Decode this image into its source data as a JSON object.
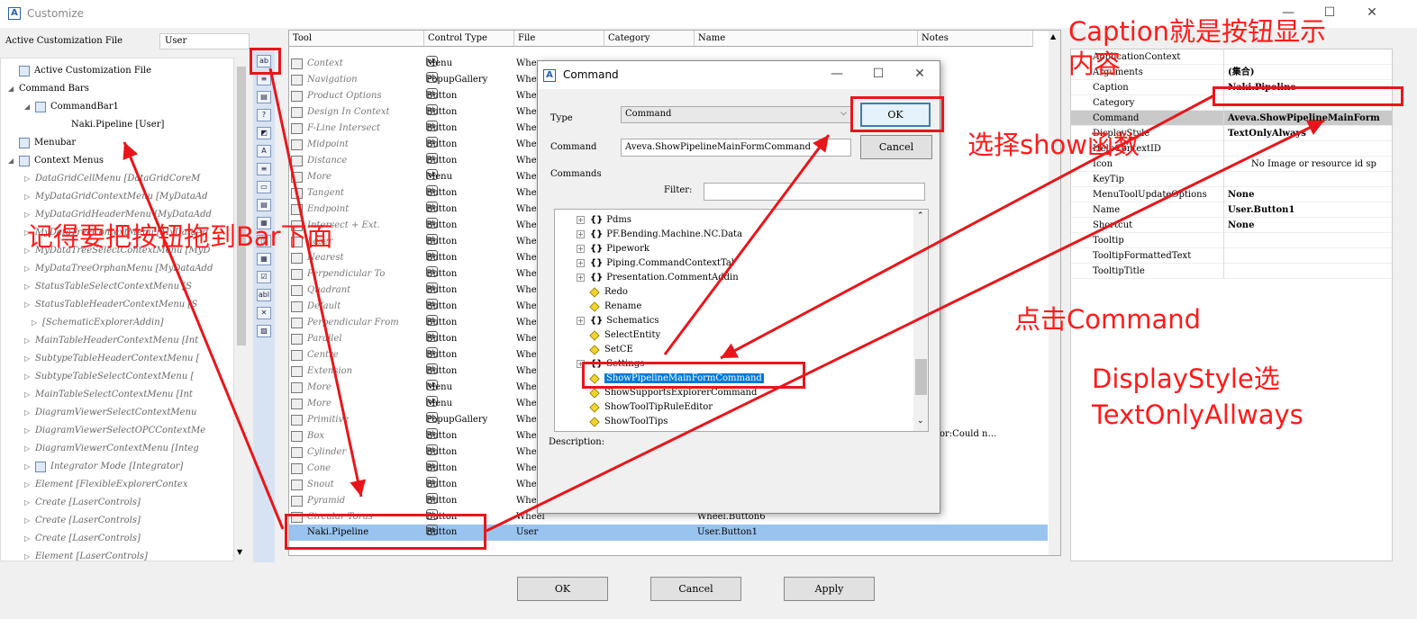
{
  "window": {
    "title": "Customize",
    "app_icon": "aveva-icon",
    "minimize": "—",
    "maximize": "☐",
    "close": "✕"
  },
  "left_panel": {
    "acf_label": "Active Customization File",
    "acf_value": "User",
    "tree": [
      {
        "label": "Active Customization File",
        "exp": "",
        "indent": 8,
        "icon": true,
        "italic": false
      },
      {
        "label": "Command Bars",
        "exp": "◢",
        "indent": 8,
        "icon": false,
        "italic": false
      },
      {
        "label": "CommandBar1",
        "exp": "◢",
        "indent": 26,
        "icon": true,
        "italic": false
      },
      {
        "label": "Naki.Pipeline [User]",
        "exp": "",
        "indent": 66,
        "icon": false,
        "italic": false
      },
      {
        "label": "Menubar",
        "exp": "",
        "indent": 8,
        "icon": true,
        "italic": false
      },
      {
        "label": "Context Menus",
        "exp": "◢",
        "indent": 8,
        "icon": true,
        "italic": false
      },
      {
        "label": "DataGridCellMenu [DataGridCoreM",
        "exp": "▷",
        "indent": 26,
        "icon": false,
        "italic": true
      },
      {
        "label": "MyDataGridContextMenu [MyDataAd",
        "exp": "▷",
        "indent": 26,
        "icon": false,
        "italic": true
      },
      {
        "label": "MyDataGridHeaderMenu [MyDataAdd",
        "exp": "▷",
        "indent": 26,
        "icon": false,
        "italic": true
      },
      {
        "label": "MyDataTreeContextMenu [MyDataAd",
        "exp": "▷",
        "indent": 26,
        "icon": false,
        "italic": true
      },
      {
        "label": "MyDataTreeSelectContextMenu [MyD",
        "exp": "▷",
        "indent": 26,
        "icon": false,
        "italic": true
      },
      {
        "label": "MyDataTreeOrphanMenu [MyDataAdd",
        "exp": "▷",
        "indent": 26,
        "icon": false,
        "italic": true
      },
      {
        "label": "StatusTableSelectContextMenu [S",
        "exp": "▷",
        "indent": 26,
        "icon": false,
        "italic": true
      },
      {
        "label": "StatusTableHeaderContextMenu [S",
        "exp": "▷",
        "indent": 26,
        "icon": false,
        "italic": true
      },
      {
        "label": "[SchematicExplorerAddin]",
        "exp": "▷",
        "indent": 34,
        "icon": false,
        "italic": true
      },
      {
        "label": "MainTableHeaderContextMenu [Int",
        "exp": "▷",
        "indent": 26,
        "icon": false,
        "italic": true
      },
      {
        "label": "SubtypeTableHeaderContextMenu [",
        "exp": "▷",
        "indent": 26,
        "icon": false,
        "italic": true
      },
      {
        "label": "SubtypeTableSelectContextMenu [",
        "exp": "▷",
        "indent": 26,
        "icon": false,
        "italic": true
      },
      {
        "label": "MainTableSelectContextMenu [Int",
        "exp": "▷",
        "indent": 26,
        "icon": false,
        "italic": true
      },
      {
        "label": "DiagramViewerSelectContextMenu",
        "exp": "▷",
        "indent": 26,
        "icon": false,
        "italic": true
      },
      {
        "label": "DiagramViewerSelectOPCContextMe",
        "exp": "▷",
        "indent": 26,
        "icon": false,
        "italic": true
      },
      {
        "label": "DiagramViewerContextMenu [Integ",
        "exp": "▷",
        "indent": 26,
        "icon": false,
        "italic": true
      },
      {
        "label": "Integrator Mode [Integrator]",
        "exp": "▷",
        "indent": 26,
        "icon": true,
        "italic": true
      },
      {
        "label": "Element [FlexibleExplorerContex",
        "exp": "▷",
        "indent": 26,
        "icon": false,
        "italic": true
      },
      {
        "label": "Create [LaserControls]",
        "exp": "▷",
        "indent": 26,
        "icon": false,
        "italic": true
      },
      {
        "label": "Create [LaserControls]",
        "exp": "▷",
        "indent": 26,
        "icon": false,
        "italic": true
      },
      {
        "label": "Create [LaserControls]",
        "exp": "▷",
        "indent": 26,
        "icon": false,
        "italic": true
      },
      {
        "label": "Element [LaserControls]",
        "exp": "▷",
        "indent": 26,
        "icon": false,
        "italic": true
      }
    ]
  },
  "toolstrip": [
    "ab",
    "≡",
    "▤",
    "?",
    "◩",
    "A",
    "≡",
    "▭",
    "▤",
    "▦",
    "◫",
    "▦",
    "☑",
    "abl",
    "✕",
    "▨"
  ],
  "grid": {
    "headers": [
      "Tool",
      "Control Type",
      "File",
      "Category",
      "Name",
      "Notes"
    ],
    "rows": [
      {
        "tool": "Context",
        "type": "Menu",
        "file": "Whe",
        "name": ""
      },
      {
        "tool": "Navigation",
        "type": "PopupGallery",
        "file": "Whe",
        "name": ""
      },
      {
        "tool": "Product Options",
        "type": "Button",
        "file": "Whe",
        "name": ""
      },
      {
        "tool": "Design In Context",
        "type": "Button",
        "file": "Whe",
        "name": ""
      },
      {
        "tool": "F-Line Intersect",
        "type": "Button",
        "file": "Whe",
        "name": ""
      },
      {
        "tool": "Midpoint",
        "type": "Button",
        "file": "Whe",
        "name": ""
      },
      {
        "tool": "Distance",
        "type": "Button",
        "file": "Whe",
        "name": ""
      },
      {
        "tool": "More",
        "type": "Menu",
        "file": "Whe",
        "name": ""
      },
      {
        "tool": "Tangent",
        "type": "Button",
        "file": "Whe",
        "name": ""
      },
      {
        "tool": "Endpoint",
        "type": "Button",
        "file": "Whe",
        "name": ""
      },
      {
        "tool": "Intersect + Ext.",
        "type": "Button",
        "file": "Whe",
        "name": ""
      },
      {
        "tool": "Laser",
        "type": "Button",
        "file": "Whe",
        "name": ""
      },
      {
        "tool": "Nearest",
        "type": "Button",
        "file": "Whe",
        "name": ""
      },
      {
        "tool": "Perpendicular To",
        "type": "Button",
        "file": "Whe",
        "name": ""
      },
      {
        "tool": "Quadrant",
        "type": "Button",
        "file": "Whe",
        "name": ""
      },
      {
        "tool": "Default",
        "type": "Button",
        "file": "Whe",
        "name": ""
      },
      {
        "tool": "Perpendicular From",
        "type": "Button",
        "file": "Whe",
        "name": ""
      },
      {
        "tool": "Parallel",
        "type": "Button",
        "file": "Whe",
        "name": ""
      },
      {
        "tool": "Centre",
        "type": "Button",
        "file": "Whe",
        "name": ""
      },
      {
        "tool": "Extension",
        "type": "Button",
        "file": "Whe",
        "name": ""
      },
      {
        "tool": "More",
        "type": "Menu",
        "file": "Whe",
        "name": ""
      },
      {
        "tool": "More",
        "type": "Menu",
        "file": "Whe",
        "name": ""
      },
      {
        "tool": "Primitive",
        "type": "PopupGallery",
        "file": "Whe",
        "name": ""
      },
      {
        "tool": "Box",
        "type": "Button",
        "file": "Whe",
        "name": ""
      },
      {
        "tool": "Cylinder",
        "type": "Button",
        "file": "Whe",
        "name": ""
      },
      {
        "tool": "Cone",
        "type": "Button",
        "file": "Whe",
        "name": ""
      },
      {
        "tool": "Snout",
        "type": "Button",
        "file": "Whe",
        "name": ""
      },
      {
        "tool": "Pyramid",
        "type": "Button",
        "file": "Whe",
        "name": ""
      },
      {
        "tool": "Circular Torus",
        "type": "Button",
        "file": "Wheel",
        "name": "Wheel.Button6"
      }
    ],
    "selected_row": {
      "tool": "Naki.Pipeline",
      "type": "Button",
      "file": "User",
      "name": "User.Button1"
    },
    "note_text": "or:Could n…"
  },
  "properties": {
    "rows": [
      {
        "name": "ApplicationContext",
        "value": ""
      },
      {
        "name": "Arguments",
        "value": "(集合)"
      },
      {
        "name": "Caption",
        "value": "Naki.Pipeline"
      },
      {
        "name": "Category",
        "value": ""
      },
      {
        "name": "Command",
        "value": "Aveva.ShowPipelineMainForm"
      },
      {
        "name": "DisplayStyle",
        "value": "TextOnlyAlways"
      },
      {
        "name": "HelpContextID",
        "value": ""
      },
      {
        "name": "Icon",
        "value": "No Image or resource id sp"
      },
      {
        "name": "KeyTip",
        "value": ""
      },
      {
        "name": "MenuToolUpdateOptions",
        "value": "None"
      },
      {
        "name": "Name",
        "value": "User.Button1"
      },
      {
        "name": "Shortcut",
        "value": "None"
      },
      {
        "name": "Tooltip",
        "value": ""
      },
      {
        "name": "TooltipFormattedText",
        "value": ""
      },
      {
        "name": "TooltipTitle",
        "value": ""
      }
    ]
  },
  "bottom_buttons": {
    "ok": "OK",
    "cancel": "Cancel",
    "apply": "Apply"
  },
  "dialog": {
    "title": "Command",
    "type_label": "Type",
    "type_value": "Command",
    "command_label": "Command",
    "command_value": "Aveva.ShowPipelineMainFormCommand",
    "ok": "OK",
    "cancel": "Cancel",
    "commands_label": "Commands",
    "filter_label": "Filter:",
    "description_label": "Description:",
    "tree": [
      {
        "label": "Pdms",
        "kind": "ns"
      },
      {
        "label": "PF.Bending.Machine.NC.Data",
        "kind": "ns"
      },
      {
        "label": "Pipework",
        "kind": "ns"
      },
      {
        "label": "Piping.CommandContextTal",
        "kind": "ns"
      },
      {
        "label": "Presentation.CommentAddin",
        "kind": "ns"
      },
      {
        "label": "Redo",
        "kind": "cmd"
      },
      {
        "label": "Rename",
        "kind": "cmd"
      },
      {
        "label": "Schematics",
        "kind": "ns"
      },
      {
        "label": "SelectEntity",
        "kind": "cmd"
      },
      {
        "label": "SetCE",
        "kind": "cmd"
      },
      {
        "label": "Settings",
        "kind": "ns"
      },
      {
        "label": "ShowPipelineMainFormCommand",
        "kind": "cmd",
        "selected": true
      },
      {
        "label": "ShowSupportsExplorerCommand",
        "kind": "cmd"
      },
      {
        "label": "ShowToolTipRuleEditor",
        "kind": "cmd"
      },
      {
        "label": "ShowToolTips",
        "kind": "cmd"
      }
    ]
  },
  "annotations": {
    "drag_to_bar": "记得要把按钮拖到Bar下面",
    "caption_note_line1": "Caption就是按钮显示",
    "caption_note_line2": "内容",
    "select_show": "选择show函数",
    "click_command": "点击Command",
    "displaystyle_line1": "DisplayStyle选",
    "displaystyle_line2": "TextOnlyAllways"
  },
  "colors": {
    "annotation": "#ff1a1a",
    "selection": "#99c4f0",
    "tree_selection": "#0078d7"
  }
}
